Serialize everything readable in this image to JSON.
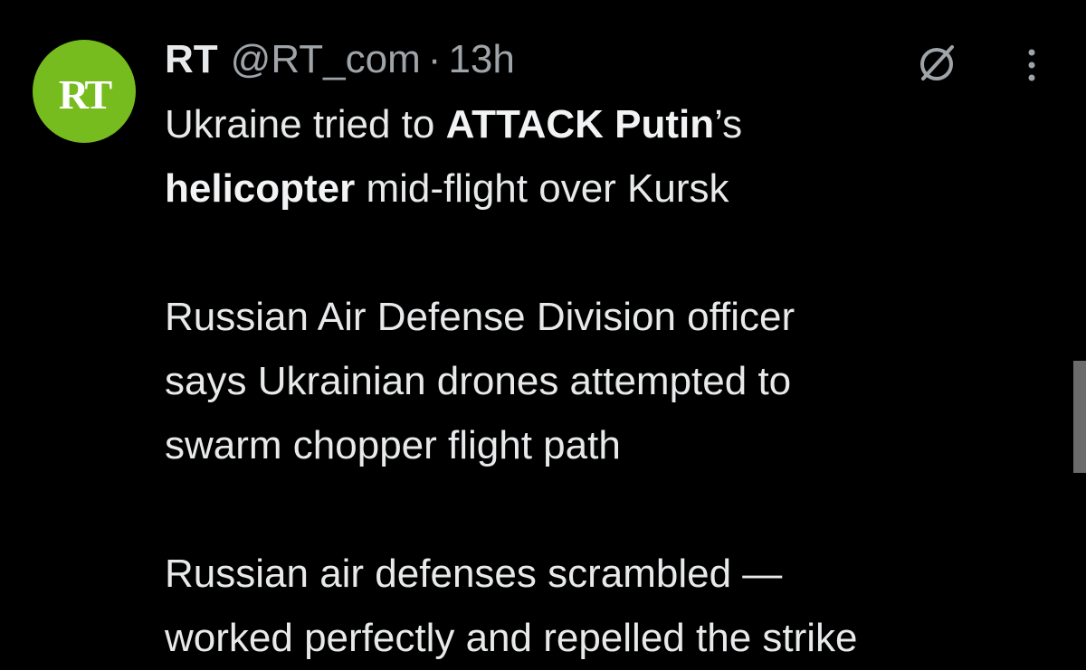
{
  "tweet": {
    "avatar_text": "RT",
    "display_name": "RT",
    "handle": "@RT_com",
    "separator": "·",
    "time": "13h",
    "line1_a": "Ukraine tried to ",
    "line1_b": "ATTACK Putin",
    "line1_c": "’s",
    "line2_a": "helicopter",
    "line2_b": " mid-flight over Kursk",
    "para2": [
      "Russian Air Defense Division officer",
      "says Ukrainian drones attempted to",
      "swarm chopper flight path"
    ],
    "para3": [
      "Russian air defenses scrambled —",
      "worked perfectly and repelled the strike"
    ]
  },
  "icons": {
    "grok": "grok-icon",
    "more": "more-icon"
  },
  "colors": {
    "background": "#000000",
    "text": "#e7e9ea",
    "muted": "#9fa4a9",
    "avatar_brand": "#77bc1f"
  }
}
